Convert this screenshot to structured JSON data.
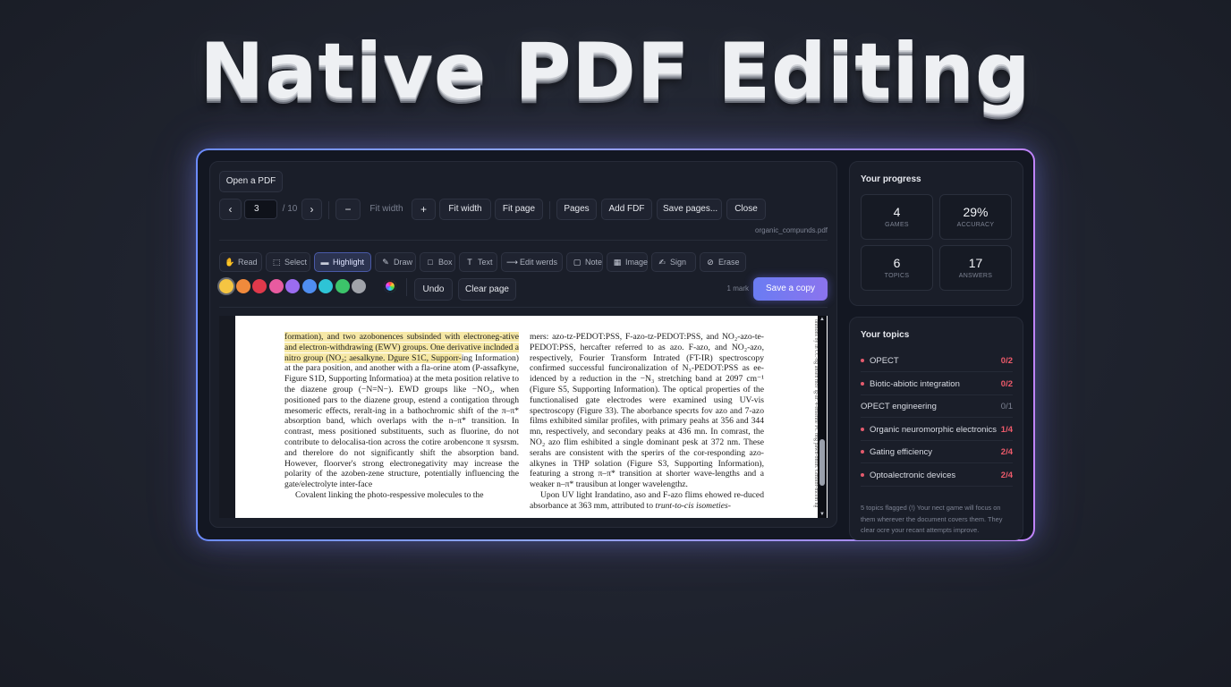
{
  "hero": {
    "title": "Native PDF Editing"
  },
  "toolbar": {
    "open_pdf": "Open a PDF",
    "prev_icon": "chevron-left-icon",
    "next_icon": "chevron-right-icon",
    "prev_glyph": "‹",
    "next_glyph": "›",
    "current_page": "3",
    "total_pages": "/ 10",
    "zoom_out": "−",
    "fit_label": "Fit width",
    "zoom_in": "+",
    "fit_width": "Fit width",
    "fit_page": "Fit page",
    "pages": "Pages",
    "add_pdf": "Add FDF",
    "save_pages": "Save pages...",
    "close": "Close",
    "filename": "organic_compunds.pdf"
  },
  "tools": [
    {
      "id": "read",
      "label": "Read",
      "icon": "hand-icon",
      "glyph": "✋"
    },
    {
      "id": "select",
      "label": "Select",
      "icon": "select-icon",
      "glyph": "⬚"
    },
    {
      "id": "highlight",
      "label": "Highlight",
      "icon": "highlight-icon",
      "glyph": "▬",
      "active": true
    },
    {
      "id": "draw",
      "label": "Draw",
      "icon": "pen-icon",
      "glyph": "✎"
    },
    {
      "id": "box",
      "label": "Box",
      "icon": "box-icon",
      "glyph": "□"
    },
    {
      "id": "text",
      "label": "Text",
      "icon": "text-icon",
      "glyph": "T"
    },
    {
      "id": "edit-words",
      "label": "Edit werds",
      "icon": "edit-words-icon",
      "glyph": "⟶"
    },
    {
      "id": "note",
      "label": "Note",
      "icon": "note-icon",
      "glyph": "▢"
    },
    {
      "id": "image",
      "label": "Image",
      "icon": "image-icon",
      "glyph": "▦"
    },
    {
      "id": "sign",
      "label": "Sign",
      "icon": "sign-icon",
      "glyph": "✍"
    },
    {
      "id": "erase",
      "label": "Erase",
      "icon": "eraser-icon",
      "glyph": "⊘"
    }
  ],
  "colors": [
    "#f5c542",
    "#f08a3c",
    "#e0394b",
    "#e85ba0",
    "#9b6cf0",
    "#4f8ef0",
    "#2ec4d6",
    "#3cc46a",
    "#a0a3aa"
  ],
  "color_picker_icon": "color-wheel-icon",
  "actions": {
    "undo": "Undo",
    "clear_page": "Clear page",
    "mark_count": "1 mark",
    "save_copy": "Save a copy"
  },
  "document": {
    "left_column": [
      {
        "text": "formation), and two azobonences subsinded with electroneg-ative and electron-withdrawing (EWV) groups. One derivative inclnded a nitro group (NO",
        "highlight": true
      },
      {
        "text": "₂",
        "highlight": true
      },
      {
        "text": "; aesalkyne. Dgure S1C, Supporr-",
        "highlight": true
      },
      {
        "text": "ing Information) at the para position, and another with a fla-orine atom (P-assafkyne, Figure S1D, Supporting Informatioa) at the meta position relative to the diazene group (−N=N−). EWD groups like −NO",
        "highlight": false
      },
      {
        "text": "₂",
        "highlight": false
      },
      {
        "text": ", when positioned pars to the diazene group, estend a contigation through mesomeric effects, reralt-ing in a bathochromic shift of the π–π* absorption band, which overlaps with the n–π* transition. In contrast, mess positioned substituents, such as fluorine, do not contribute to delocalisa-tion across the cotire arobencone π sysrsm. and therelore do not significantly shift the absorption band. However, floorver's strong electronegativity may increase the polarity of the azoben-zene structure, potentially influencing the gate/electrolyte inter-face",
        "highlight": false
      }
    ],
    "left_para2": "Covalent linking the photo-respessive molecules to the",
    "right_column": "mers: azo-tz-PEDOT:PSS, F-azo-tz-PEDOT:PSS, and NO₂-azo-te-PEDOT:PSS, hercafter referred to as azo. F-azo, and NO₂-azo, respectively, Fourier Transform Intrated (FT-IR) spectroscopy confirmed successful funcironalization of N₃-PEDOT:PSS as ee-idenced by a reduction in the −N₃ stretching band at 2097 cm⁻¹ (Figure S5, Supporting Information). The optical properties of the functionalised gate electrodes were examined using UV-vis spectroscopy (Figure 33). The aborbance specrts fov azo and 7-azo films exhibited similar profiles, with primary peahs at 356 and 344 mn, respectively, and secondary peaks at 436 mn. In comrast, the NO₂ azo flim eshibited a single dominant pesk at 372 nm. These serahs are consistent with the sperirs of the cor-responding azo-alkynes in THP solation (Figure S3, Supporting Information), featuring a strong π–π* transition at shorter wave-lengths and a weaker n–π* trausibun at longer wavelengthz.",
    "right_para2": "Upon UV light Irandatino, aso and F-azo flims ehowed re-duced absorbance at 363 mm, attributed to",
    "right_para2_italic": "trunt-to-cis isometies-",
    "margin_text": "onmons by ln CC-ng ansen mce lg-ar. 4-ensenne PC bng pawn-ontin. Gmolbr-mcem ng Gecnom-mce-cep.ce"
  },
  "progress": {
    "title": "Your progress",
    "stats": [
      {
        "value": "4",
        "label": "GAMES"
      },
      {
        "value": "29%",
        "label": "ACCURACY"
      },
      {
        "value": "6",
        "label": "TOPICS"
      },
      {
        "value": "17",
        "label": "ANSWERS"
      }
    ]
  },
  "topics": {
    "title": "Your topics",
    "items": [
      {
        "name": "OPECT",
        "score": "0/2",
        "flagged": true
      },
      {
        "name": "Biotic-abiotic integration",
        "score": "0/2",
        "flagged": true
      },
      {
        "name": "OPECT engineering",
        "score": "0/1",
        "flagged": false
      },
      {
        "name": "Organic neuromorphic electronics",
        "score": "1/4",
        "flagged": true
      },
      {
        "name": "Gating efficiency",
        "score": "2/4",
        "flagged": true
      },
      {
        "name": "Optoalectronic devices",
        "score": "2/4",
        "flagged": true
      }
    ],
    "note": "5 topics flagged (!) Your nect game will focus on them wherever the document covers them. They clear ocre your recant attempts improve."
  }
}
